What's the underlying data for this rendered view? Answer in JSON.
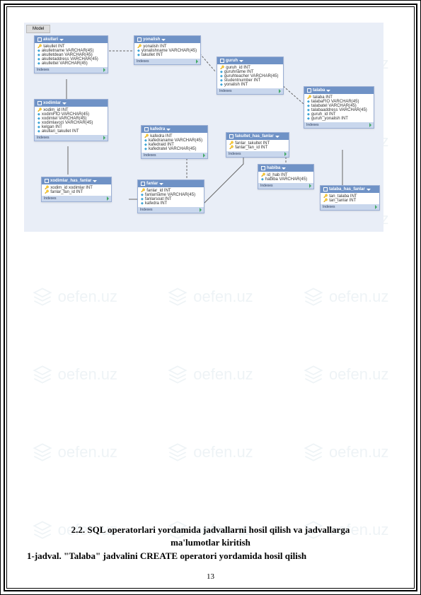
{
  "watermark_text": "oefen.uz",
  "diagram": {
    "model_tab": "Model",
    "tables": {
      "akullari": {
        "title": "akullari",
        "rows": [
          {
            "k": "key",
            "t": "takullet INT"
          },
          {
            "k": "dia",
            "t": "akulletname VARCHAR(45)"
          },
          {
            "k": "dia",
            "t": "akulletdean VARCHAR(45)"
          },
          {
            "k": "dia",
            "t": "akulletaddress VARCHAR(45)"
          },
          {
            "k": "dia",
            "t": "akullettel VARCHAR(45)"
          }
        ]
      },
      "yonalish": {
        "title": "yonalish",
        "rows": [
          {
            "k": "key",
            "t": "yonalish INT"
          },
          {
            "k": "dia",
            "t": "yonalishname VARCHAR(45)"
          },
          {
            "k": "dia",
            "t": "takullet INT"
          }
        ]
      },
      "guruh": {
        "title": "guruh",
        "rows": [
          {
            "k": "key",
            "t": "guruh_id INT"
          },
          {
            "k": "dia",
            "t": "guruhname INT"
          },
          {
            "k": "dia",
            "t": "guruhteacher VARCHAR(45)"
          },
          {
            "k": "dia",
            "t": "studentnumber INT"
          },
          {
            "k": "dia",
            "t": "yonalish INT"
          }
        ]
      },
      "talaba": {
        "title": "talaba",
        "rows": [
          {
            "k": "key",
            "t": "talaba INT"
          },
          {
            "k": "dia",
            "t": "talabaFIO VARCHAR(45)"
          },
          {
            "k": "dia",
            "t": "talabatel VARCHAR(45)"
          },
          {
            "k": "dia",
            "t": "talabaaddress VARCHAR(45)"
          },
          {
            "k": "dia",
            "t": "guruh_id INT"
          },
          {
            "k": "dia",
            "t": "guruh_yonalish INT"
          }
        ]
      },
      "xodimlar": {
        "title": "xodimlar",
        "rows": [
          {
            "k": "key",
            "t": "xodim_id INT"
          },
          {
            "k": "dia",
            "t": "xodimFIO VARCHAR(45)"
          },
          {
            "k": "dia",
            "t": "xodimtel VARCHAR(45)"
          },
          {
            "k": "dia",
            "t": "xodimlavozi VARCHAR(45)"
          },
          {
            "k": "dia",
            "t": "kelgan INT"
          },
          {
            "k": "dia",
            "t": "akullari_takullet INT"
          }
        ]
      },
      "kafedra": {
        "title": "kafedra",
        "rows": [
          {
            "k": "key",
            "t": "kafedra INT"
          },
          {
            "k": "dia",
            "t": "kafedraname VARCHAR(45)"
          },
          {
            "k": "dia",
            "t": "kafedraid INT"
          },
          {
            "k": "dia",
            "t": "kafedratel VARCHAR(45)"
          }
        ]
      },
      "fakultet_has_fanlar": {
        "title": "fakultet_has_fanlar",
        "rows": [
          {
            "k": "key",
            "t": "fanlar_takultet INT"
          },
          {
            "k": "key",
            "t": "fanlar_fan_id INT"
          }
        ]
      },
      "habiba": {
        "title": "habiba",
        "rows": [
          {
            "k": "key",
            "t": "id_hab INT"
          },
          {
            "k": "dia",
            "t": "habiba VARCHAR(45)"
          }
        ]
      },
      "talaba_has_fanlar": {
        "title": "talaba_has_fanlar",
        "rows": [
          {
            "k": "key",
            "t": "tan_talaba INT"
          },
          {
            "k": "key",
            "t": "tan_tanlar INT"
          }
        ]
      },
      "xodimlar_has_fanlar": {
        "title": "xodimlar_has_fanlar",
        "rows": [
          {
            "k": "key",
            "t": "xodim_id xodimlar INT"
          },
          {
            "k": "key",
            "t": "fanlar_fan_id INT"
          }
        ]
      },
      "fanlar": {
        "title": "fanlar",
        "rows": [
          {
            "k": "key",
            "t": "fanlar_id INT"
          },
          {
            "k": "dia",
            "t": "fanlarname VARCHAR(45)"
          },
          {
            "k": "dia",
            "t": "fanlarsoat INT"
          },
          {
            "k": "dia",
            "t": "kafedra INT"
          }
        ]
      }
    },
    "indexes_label": "Indexes"
  },
  "text": {
    "heading": "2.2. SQL operatorlari yordamida jadvallarni hosil qilish va jadvallarga",
    "heading2": "ma'lumotlar kiritish",
    "row1": "1-jadval. \"Talaba\" jadvalini CREATE operatori yordamida hosil qilish"
  },
  "page_number": "13"
}
